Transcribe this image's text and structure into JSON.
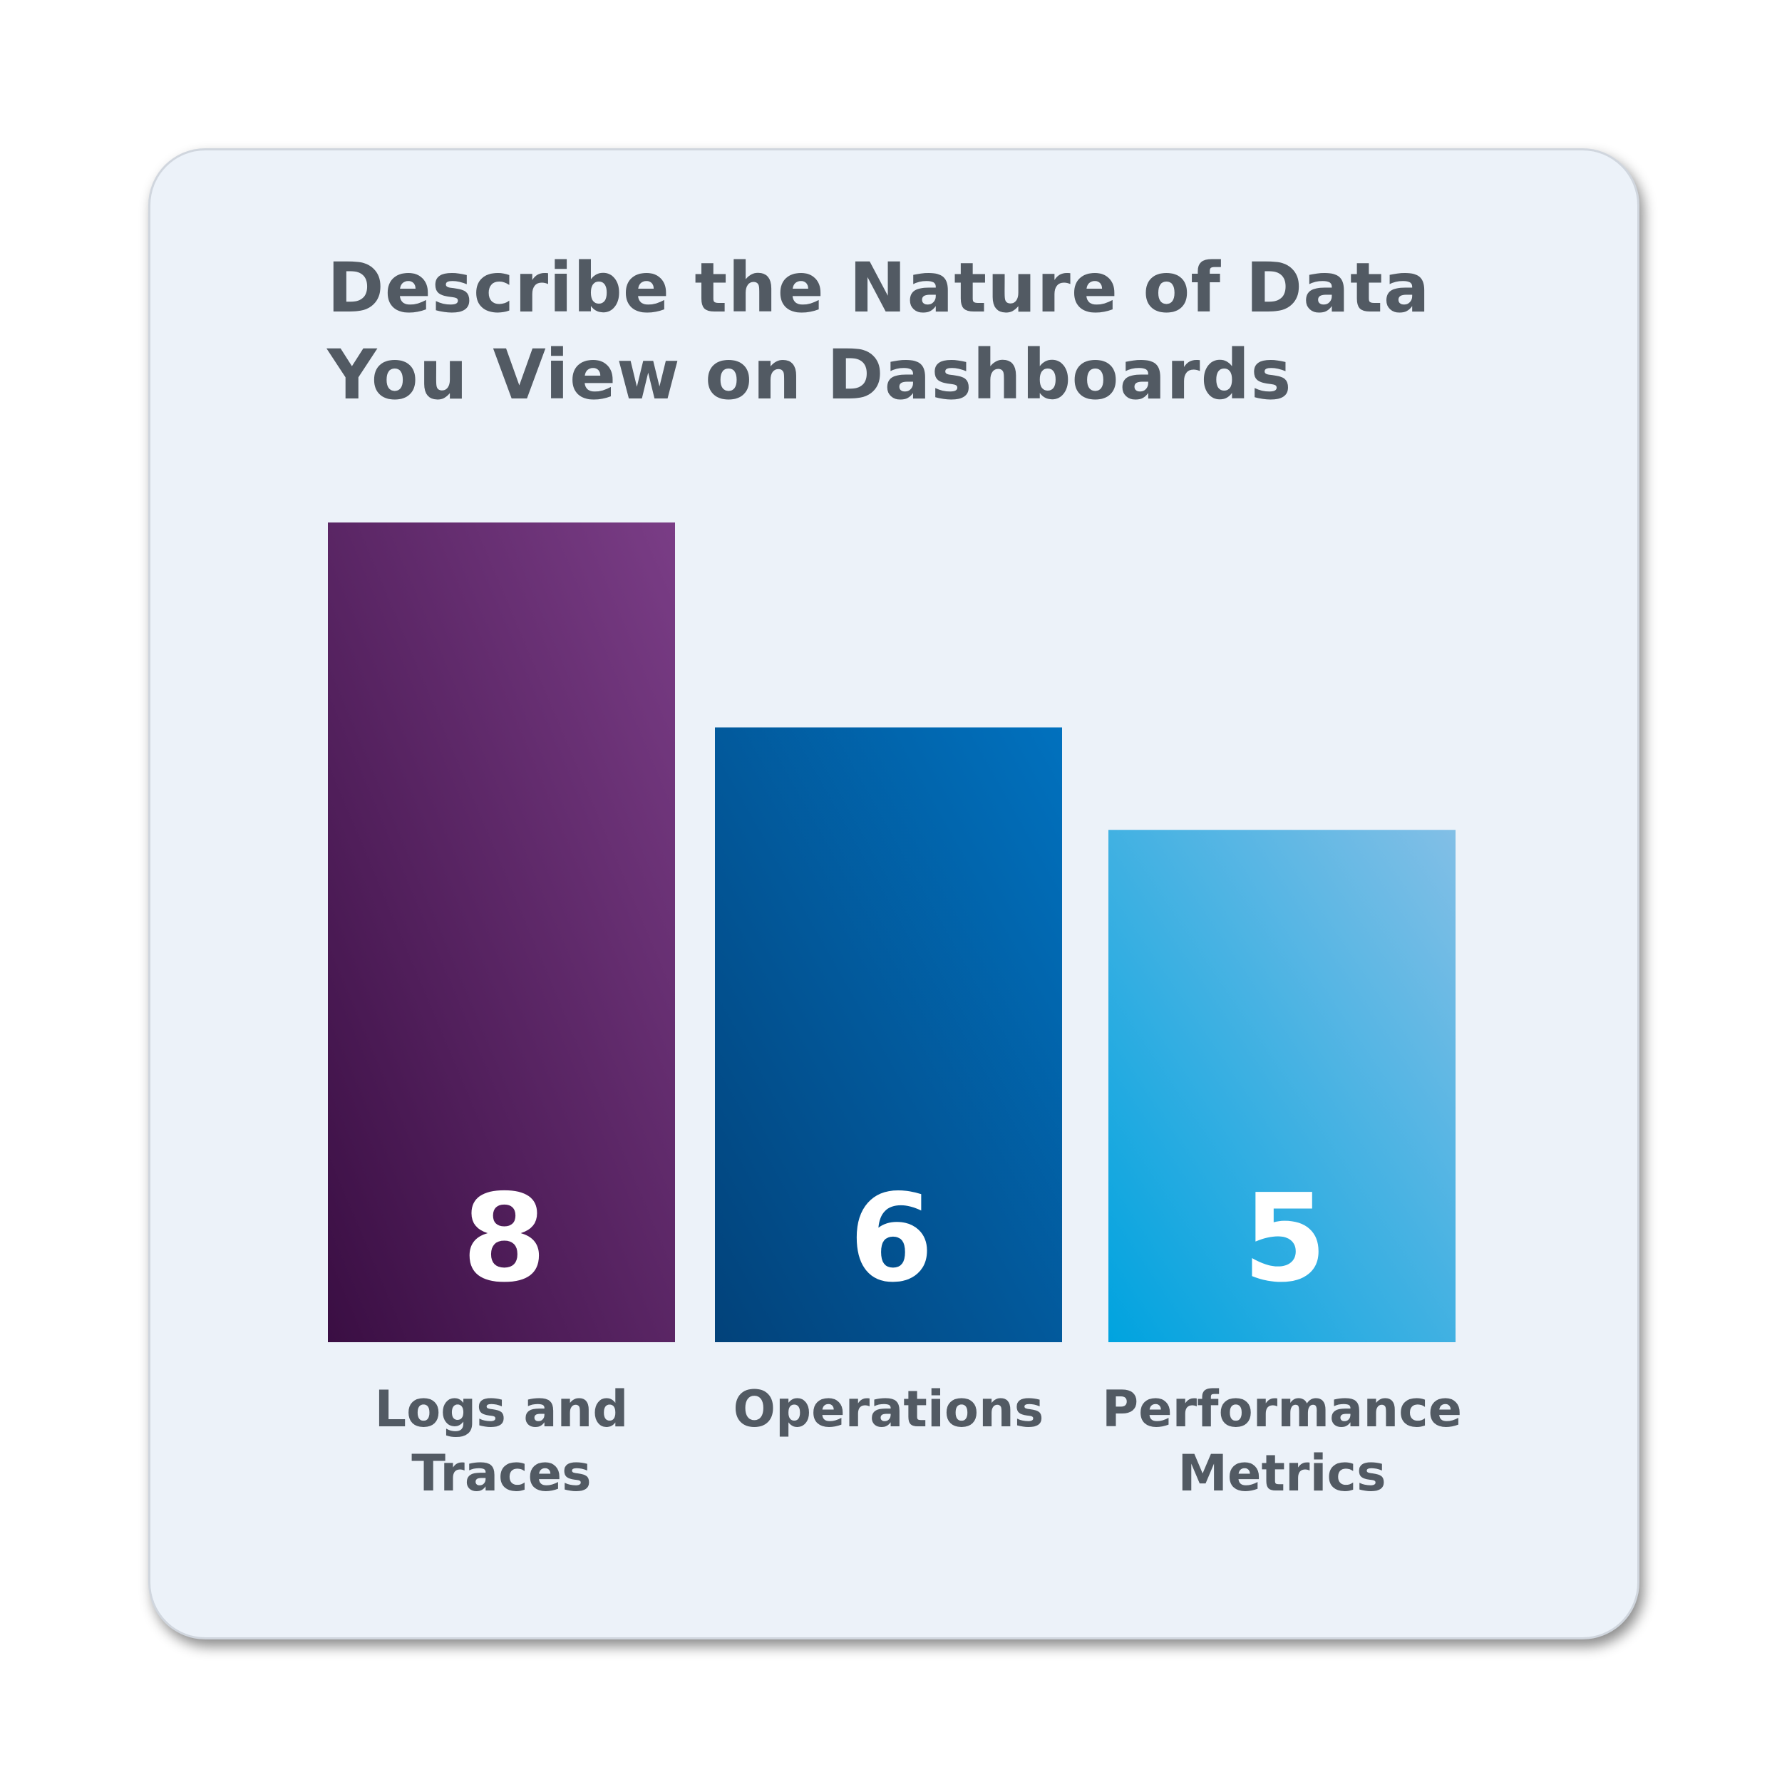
{
  "chart_data": {
    "type": "bar",
    "title": "Describe the Nature of Data You View on Dashboards",
    "title_lines": [
      "Describe the Nature of Data",
      "You View on Dashboards"
    ],
    "categories": [
      "Logs and Traces",
      "Operations",
      "Performance Metrics"
    ],
    "category_lines": [
      [
        "Logs and",
        "Traces"
      ],
      [
        "Operations"
      ],
      [
        "Performance",
        "Metrics"
      ]
    ],
    "values": [
      8,
      6,
      5
    ],
    "value_labels": [
      "8",
      "6",
      "5"
    ],
    "ylim": [
      0,
      8
    ],
    "grid": false,
    "colors": [
      {
        "start": "#3a0e43",
        "end": "#7a3d86"
      },
      {
        "start": "#02427a",
        "end": "#0171be"
      },
      {
        "start": "#00a3df",
        "end": "#82bfe6"
      }
    ],
    "label_color": "#525a63",
    "background": "#ecf2f9"
  }
}
